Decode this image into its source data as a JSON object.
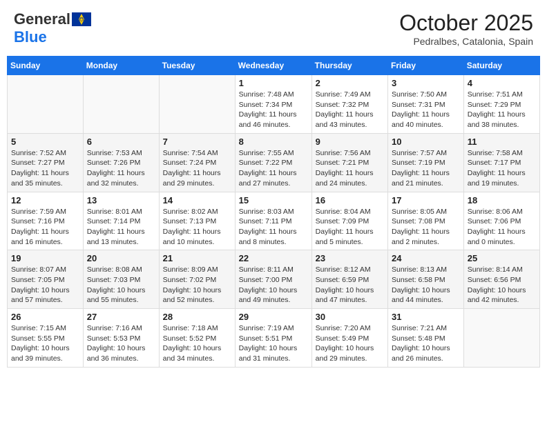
{
  "header": {
    "logo_general": "General",
    "logo_blue": "Blue",
    "title": "October 2025",
    "subtitle": "Pedralbes, Catalonia, Spain"
  },
  "days_of_week": [
    "Sunday",
    "Monday",
    "Tuesday",
    "Wednesday",
    "Thursday",
    "Friday",
    "Saturday"
  ],
  "weeks": [
    {
      "cells": [
        {
          "day": "",
          "info": ""
        },
        {
          "day": "",
          "info": ""
        },
        {
          "day": "",
          "info": ""
        },
        {
          "day": "1",
          "info": "Sunrise: 7:48 AM\nSunset: 7:34 PM\nDaylight: 11 hours\nand 46 minutes."
        },
        {
          "day": "2",
          "info": "Sunrise: 7:49 AM\nSunset: 7:32 PM\nDaylight: 11 hours\nand 43 minutes."
        },
        {
          "day": "3",
          "info": "Sunrise: 7:50 AM\nSunset: 7:31 PM\nDaylight: 11 hours\nand 40 minutes."
        },
        {
          "day": "4",
          "info": "Sunrise: 7:51 AM\nSunset: 7:29 PM\nDaylight: 11 hours\nand 38 minutes."
        }
      ]
    },
    {
      "cells": [
        {
          "day": "5",
          "info": "Sunrise: 7:52 AM\nSunset: 7:27 PM\nDaylight: 11 hours\nand 35 minutes."
        },
        {
          "day": "6",
          "info": "Sunrise: 7:53 AM\nSunset: 7:26 PM\nDaylight: 11 hours\nand 32 minutes."
        },
        {
          "day": "7",
          "info": "Sunrise: 7:54 AM\nSunset: 7:24 PM\nDaylight: 11 hours\nand 29 minutes."
        },
        {
          "day": "8",
          "info": "Sunrise: 7:55 AM\nSunset: 7:22 PM\nDaylight: 11 hours\nand 27 minutes."
        },
        {
          "day": "9",
          "info": "Sunrise: 7:56 AM\nSunset: 7:21 PM\nDaylight: 11 hours\nand 24 minutes."
        },
        {
          "day": "10",
          "info": "Sunrise: 7:57 AM\nSunset: 7:19 PM\nDaylight: 11 hours\nand 21 minutes."
        },
        {
          "day": "11",
          "info": "Sunrise: 7:58 AM\nSunset: 7:17 PM\nDaylight: 11 hours\nand 19 minutes."
        }
      ]
    },
    {
      "cells": [
        {
          "day": "12",
          "info": "Sunrise: 7:59 AM\nSunset: 7:16 PM\nDaylight: 11 hours\nand 16 minutes."
        },
        {
          "day": "13",
          "info": "Sunrise: 8:01 AM\nSunset: 7:14 PM\nDaylight: 11 hours\nand 13 minutes."
        },
        {
          "day": "14",
          "info": "Sunrise: 8:02 AM\nSunset: 7:13 PM\nDaylight: 11 hours\nand 10 minutes."
        },
        {
          "day": "15",
          "info": "Sunrise: 8:03 AM\nSunset: 7:11 PM\nDaylight: 11 hours\nand 8 minutes."
        },
        {
          "day": "16",
          "info": "Sunrise: 8:04 AM\nSunset: 7:09 PM\nDaylight: 11 hours\nand 5 minutes."
        },
        {
          "day": "17",
          "info": "Sunrise: 8:05 AM\nSunset: 7:08 PM\nDaylight: 11 hours\nand 2 minutes."
        },
        {
          "day": "18",
          "info": "Sunrise: 8:06 AM\nSunset: 7:06 PM\nDaylight: 11 hours\nand 0 minutes."
        }
      ]
    },
    {
      "cells": [
        {
          "day": "19",
          "info": "Sunrise: 8:07 AM\nSunset: 7:05 PM\nDaylight: 10 hours\nand 57 minutes."
        },
        {
          "day": "20",
          "info": "Sunrise: 8:08 AM\nSunset: 7:03 PM\nDaylight: 10 hours\nand 55 minutes."
        },
        {
          "day": "21",
          "info": "Sunrise: 8:09 AM\nSunset: 7:02 PM\nDaylight: 10 hours\nand 52 minutes."
        },
        {
          "day": "22",
          "info": "Sunrise: 8:11 AM\nSunset: 7:00 PM\nDaylight: 10 hours\nand 49 minutes."
        },
        {
          "day": "23",
          "info": "Sunrise: 8:12 AM\nSunset: 6:59 PM\nDaylight: 10 hours\nand 47 minutes."
        },
        {
          "day": "24",
          "info": "Sunrise: 8:13 AM\nSunset: 6:58 PM\nDaylight: 10 hours\nand 44 minutes."
        },
        {
          "day": "25",
          "info": "Sunrise: 8:14 AM\nSunset: 6:56 PM\nDaylight: 10 hours\nand 42 minutes."
        }
      ]
    },
    {
      "cells": [
        {
          "day": "26",
          "info": "Sunrise: 7:15 AM\nSunset: 5:55 PM\nDaylight: 10 hours\nand 39 minutes."
        },
        {
          "day": "27",
          "info": "Sunrise: 7:16 AM\nSunset: 5:53 PM\nDaylight: 10 hours\nand 36 minutes."
        },
        {
          "day": "28",
          "info": "Sunrise: 7:18 AM\nSunset: 5:52 PM\nDaylight: 10 hours\nand 34 minutes."
        },
        {
          "day": "29",
          "info": "Sunrise: 7:19 AM\nSunset: 5:51 PM\nDaylight: 10 hours\nand 31 minutes."
        },
        {
          "day": "30",
          "info": "Sunrise: 7:20 AM\nSunset: 5:49 PM\nDaylight: 10 hours\nand 29 minutes."
        },
        {
          "day": "31",
          "info": "Sunrise: 7:21 AM\nSunset: 5:48 PM\nDaylight: 10 hours\nand 26 minutes."
        },
        {
          "day": "",
          "info": ""
        }
      ]
    }
  ]
}
